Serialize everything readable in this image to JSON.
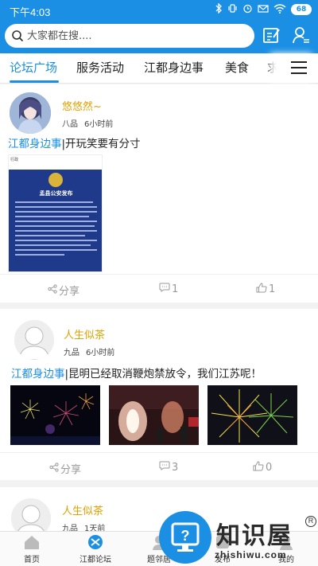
{
  "status_bar": {
    "time": "下午4:03",
    "battery": "68"
  },
  "search": {
    "placeholder": "大家都在搜...."
  },
  "tabs": [
    {
      "label": "论坛广场",
      "active": true
    },
    {
      "label": "服务活动"
    },
    {
      "label": "江都身边事"
    },
    {
      "label": "美食"
    },
    {
      "label": "求"
    }
  ],
  "posts": [
    {
      "user": "悠悠然~",
      "level": "八品",
      "time": "6小时前",
      "tag": "江都身边事",
      "title": "|开玩笑要有分寸",
      "notice": {
        "header_left": "行政",
        "authority": "孟县公安发布"
      },
      "share_label": "分享",
      "comments": "1",
      "likes": "1"
    },
    {
      "user": "人生似茶",
      "level": "九品",
      "time": "6小时前",
      "tag": "江都身边事",
      "title": "|昆明已经取消鞭炮禁放令，我们江苏呢！",
      "share_label": "分享",
      "comments": "3",
      "likes": "0"
    },
    {
      "user": "人生似茶",
      "level": "九品",
      "time": "1天前"
    }
  ],
  "bottom_nav": [
    {
      "label": "首页",
      "icon": "home-icon"
    },
    {
      "label": "江都论坛",
      "icon": "forum-icon"
    },
    {
      "label": "题邻居",
      "icon": "neighbor-icon"
    },
    {
      "label": "发布",
      "icon": "post-icon"
    },
    {
      "label": "我的",
      "icon": "profile-icon"
    }
  ],
  "watermark": {
    "title": "知识屋",
    "subtitle": "zhishiwu.com",
    "mark": "R",
    "badge_glyph": "?"
  },
  "colors": {
    "brand_blue": "#1a8fe3",
    "username_gold": "#e0a100"
  }
}
